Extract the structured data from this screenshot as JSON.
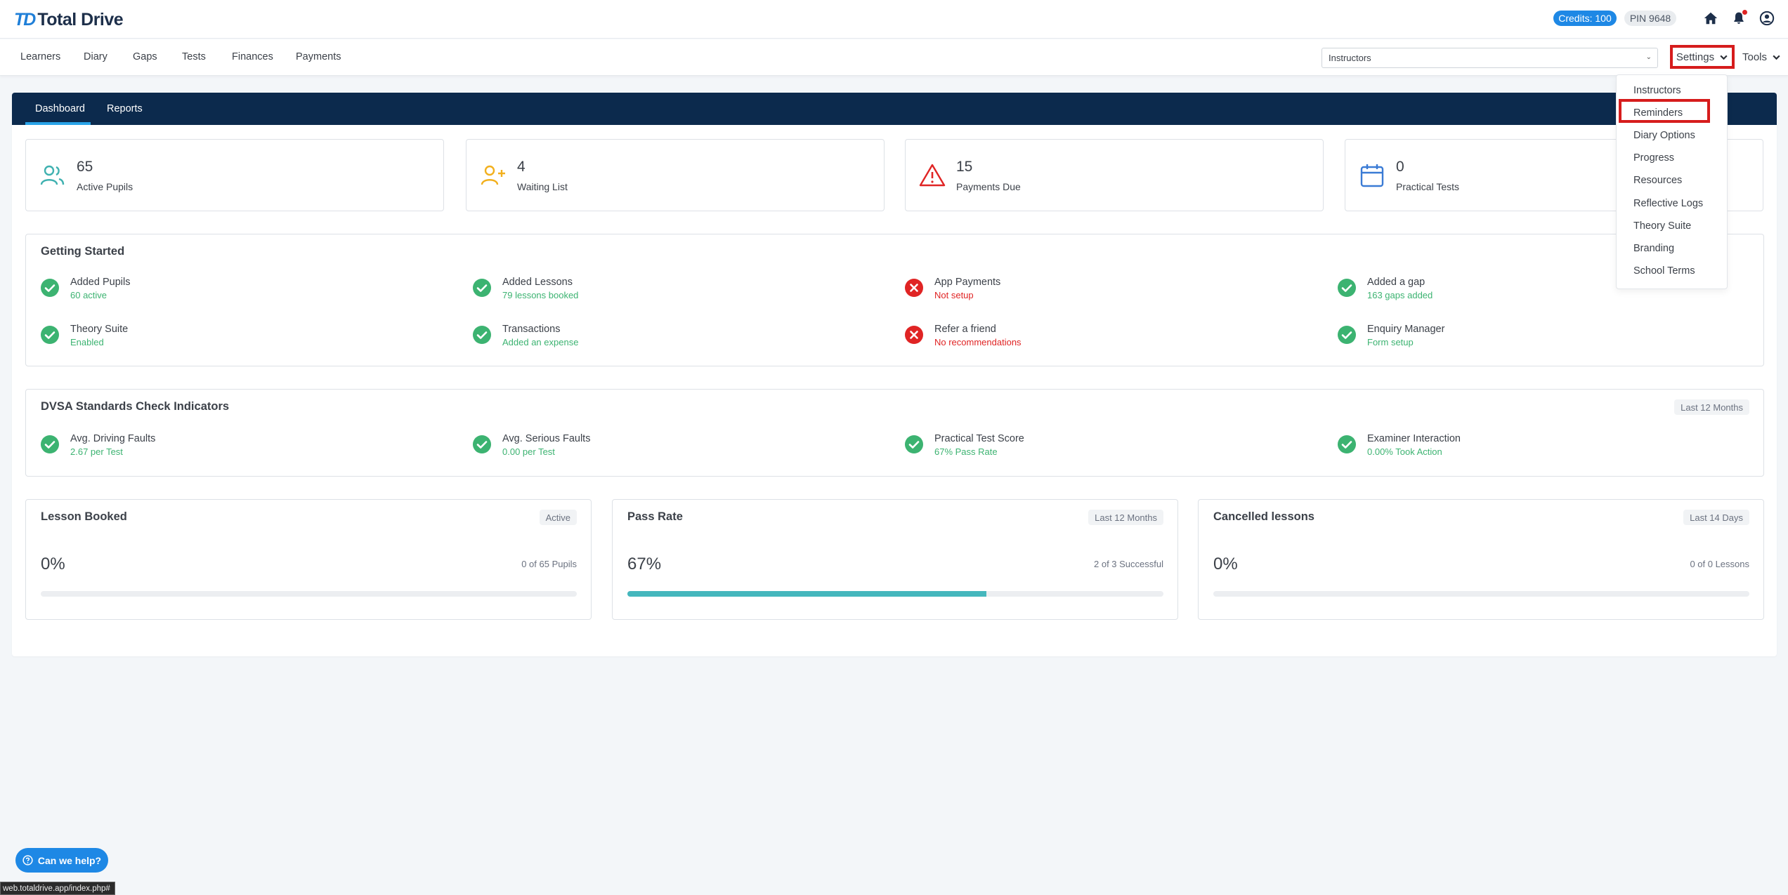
{
  "header": {
    "logo_mark": "TD",
    "logo_text": "Total Drive",
    "credits": "Credits: 100",
    "pin": "PIN 9648",
    "icons": [
      "home-icon",
      "bell-icon",
      "user-icon"
    ]
  },
  "nav": {
    "items": [
      "Learners",
      "Diary",
      "Gaps",
      "Tests",
      "Finances",
      "Payments"
    ],
    "instructor_select": "Instructors",
    "settings": "Settings",
    "tools": "Tools"
  },
  "settings_menu": {
    "items": [
      "Instructors",
      "Reminders",
      "Diary Options",
      "Progress",
      "Resources",
      "Reflective Logs",
      "Theory Suite",
      "Branding",
      "School Terms"
    ],
    "highlighted": "Reminders"
  },
  "tabs": [
    "Dashboard",
    "Reports"
  ],
  "stats": [
    {
      "value": "65",
      "label": "Active Pupils",
      "icon": "users-icon"
    },
    {
      "value": "4",
      "label": "Waiting List",
      "icon": "user-plus-icon"
    },
    {
      "value": "15",
      "label": "Payments Due",
      "icon": "alert-triangle-icon"
    },
    {
      "value": "0",
      "label": "Practical Tests",
      "icon": "calendar-icon"
    }
  ],
  "getting_started": {
    "title": "Getting Started",
    "items": [
      {
        "title": "Added Pupils",
        "sub": "60 active",
        "status": "ok"
      },
      {
        "title": "Added Lessons",
        "sub": "79 lessons booked",
        "status": "ok"
      },
      {
        "title": "App Payments",
        "sub": "Not setup",
        "status": "error"
      },
      {
        "title": "Added a gap",
        "sub": "163 gaps added",
        "status": "ok"
      },
      {
        "title": "Theory Suite",
        "sub": "Enabled",
        "status": "ok"
      },
      {
        "title": "Transactions",
        "sub": "Added an expense",
        "status": "ok"
      },
      {
        "title": "Refer a friend",
        "sub": "No recommendations",
        "status": "error"
      },
      {
        "title": "Enquiry Manager",
        "sub": "Form setup",
        "status": "ok"
      }
    ]
  },
  "dvsa": {
    "title": "DVSA Standards Check Indicators",
    "badge": "Last 12 Months",
    "items": [
      {
        "title": "Avg. Driving Faults",
        "sub": "2.67 per Test"
      },
      {
        "title": "Avg. Serious Faults",
        "sub": "0.00 per Test"
      },
      {
        "title": "Practical Test Score",
        "sub": "67% Pass Rate"
      },
      {
        "title": "Examiner Interaction",
        "sub": "0.00% Took Action"
      }
    ]
  },
  "metrics": [
    {
      "title": "Lesson Booked",
      "badge": "Active",
      "value": "0%",
      "note": "0 of 65 Pupils",
      "progress": 0
    },
    {
      "title": "Pass Rate",
      "badge": "Last 12 Months",
      "value": "67%",
      "note": "2 of 3 Successful",
      "progress": 0.67
    },
    {
      "title": "Cancelled lessons",
      "badge": "Last 14 Days",
      "value": "0%",
      "note": "0 of 0 Lessons",
      "progress": 0
    }
  ],
  "help_button": "Can we help?",
  "status_url": "web.totaldrive.app/index.php#",
  "colors": {
    "navy": "#0c2a4d",
    "blue": "#1e88e5",
    "green": "#3cb371",
    "red": "#e02424",
    "teal": "#45b7bd",
    "highlight": "#d61c1c"
  }
}
